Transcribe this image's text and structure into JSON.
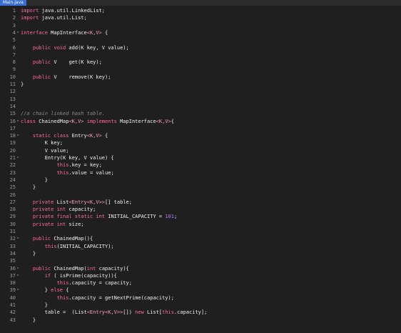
{
  "tab": {
    "label": "Main.java"
  },
  "editor": {
    "lines": [
      {
        "n": "1",
        "fold": "",
        "tokens": [
          [
            "kw",
            "import"
          ],
          [
            "plain",
            " java.util.LinkedList;"
          ]
        ]
      },
      {
        "n": "2",
        "fold": "",
        "tokens": [
          [
            "kw",
            "import"
          ],
          [
            "plain",
            " java.util.List;"
          ]
        ]
      },
      {
        "n": "3",
        "fold": "",
        "tokens": []
      },
      {
        "n": "4",
        "fold": "▾",
        "tokens": [
          [
            "kw",
            "interface"
          ],
          [
            "plain",
            " MapInterface"
          ],
          [
            "typ",
            "<K,V>"
          ],
          [
            "plain",
            " {"
          ]
        ]
      },
      {
        "n": "5",
        "fold": "",
        "tokens": []
      },
      {
        "n": "6",
        "fold": "",
        "tokens": [
          [
            "plain",
            "    "
          ],
          [
            "kw",
            "public void"
          ],
          [
            "plain",
            " add(K key, V value);"
          ]
        ]
      },
      {
        "n": "7",
        "fold": "",
        "tokens": []
      },
      {
        "n": "8",
        "fold": "",
        "tokens": [
          [
            "plain",
            "    "
          ],
          [
            "kw",
            "public"
          ],
          [
            "plain",
            " V    get(K key);"
          ]
        ]
      },
      {
        "n": "9",
        "fold": "",
        "tokens": []
      },
      {
        "n": "10",
        "fold": "",
        "tokens": [
          [
            "plain",
            "    "
          ],
          [
            "kw",
            "public"
          ],
          [
            "plain",
            " V    remove(K key);"
          ]
        ]
      },
      {
        "n": "11",
        "fold": "",
        "tokens": [
          [
            "plain",
            "}"
          ]
        ]
      },
      {
        "n": "12",
        "fold": "",
        "tokens": []
      },
      {
        "n": "13",
        "fold": "",
        "tokens": []
      },
      {
        "n": "14",
        "fold": "",
        "tokens": []
      },
      {
        "n": "15",
        "fold": "",
        "tokens": [
          [
            "com",
            "//a chain linked hash table."
          ]
        ]
      },
      {
        "n": "16",
        "fold": "▾",
        "tokens": [
          [
            "kw",
            "class"
          ],
          [
            "plain",
            " ChainedMap"
          ],
          [
            "typ",
            "<K,V>"
          ],
          [
            "kw",
            " implements"
          ],
          [
            "plain",
            " MapInterface"
          ],
          [
            "typ",
            "<K,V>"
          ],
          [
            "plain",
            "{"
          ]
        ]
      },
      {
        "n": "17",
        "fold": "",
        "tokens": []
      },
      {
        "n": "18",
        "fold": "▾",
        "tokens": [
          [
            "plain",
            "    "
          ],
          [
            "kw",
            "static class"
          ],
          [
            "plain",
            " Entry"
          ],
          [
            "typ",
            "<K,V>"
          ],
          [
            "plain",
            " {"
          ]
        ]
      },
      {
        "n": "19",
        "fold": "",
        "tokens": [
          [
            "plain",
            "        K key;"
          ]
        ]
      },
      {
        "n": "20",
        "fold": "",
        "tokens": [
          [
            "plain",
            "        V value;"
          ]
        ]
      },
      {
        "n": "21",
        "fold": "▾",
        "tokens": [
          [
            "plain",
            "        Entry(K key, V value) {"
          ]
        ]
      },
      {
        "n": "22",
        "fold": "",
        "tokens": [
          [
            "plain",
            "            "
          ],
          [
            "kw",
            "this"
          ],
          [
            "plain",
            ".key = key;"
          ]
        ]
      },
      {
        "n": "23",
        "fold": "",
        "tokens": [
          [
            "plain",
            "            "
          ],
          [
            "kw",
            "this"
          ],
          [
            "plain",
            ".value = value;"
          ]
        ]
      },
      {
        "n": "24",
        "fold": "",
        "tokens": [
          [
            "plain",
            "        }"
          ]
        ]
      },
      {
        "n": "25",
        "fold": "",
        "tokens": [
          [
            "plain",
            "    }"
          ]
        ]
      },
      {
        "n": "26",
        "fold": "",
        "tokens": []
      },
      {
        "n": "27",
        "fold": "",
        "tokens": [
          [
            "plain",
            "    "
          ],
          [
            "kw",
            "private"
          ],
          [
            "plain",
            " List"
          ],
          [
            "typ",
            "<Entry<K,V>>"
          ],
          [
            "plain",
            "[] table;"
          ]
        ]
      },
      {
        "n": "28",
        "fold": "",
        "tokens": [
          [
            "plain",
            "    "
          ],
          [
            "kw",
            "private int"
          ],
          [
            "plain",
            " capacity;"
          ]
        ]
      },
      {
        "n": "29",
        "fold": "",
        "tokens": [
          [
            "plain",
            "    "
          ],
          [
            "kw",
            "private final static int"
          ],
          [
            "plain",
            " INITIAL_CAPACITY = "
          ],
          [
            "num",
            "101"
          ],
          [
            "plain",
            ";"
          ]
        ]
      },
      {
        "n": "30",
        "fold": "",
        "tokens": [
          [
            "plain",
            "    "
          ],
          [
            "kw",
            "private int"
          ],
          [
            "plain",
            " size;"
          ]
        ]
      },
      {
        "n": "31",
        "fold": "",
        "tokens": []
      },
      {
        "n": "32",
        "fold": "▾",
        "tokens": [
          [
            "plain",
            "    "
          ],
          [
            "kw",
            "public"
          ],
          [
            "plain",
            " ChainedMap(){"
          ]
        ]
      },
      {
        "n": "33",
        "fold": "",
        "tokens": [
          [
            "plain",
            "        "
          ],
          [
            "kw",
            "this"
          ],
          [
            "plain",
            "(INITIAL_CAPACITY);"
          ]
        ]
      },
      {
        "n": "34",
        "fold": "",
        "tokens": [
          [
            "plain",
            "    }"
          ]
        ]
      },
      {
        "n": "35",
        "fold": "",
        "tokens": []
      },
      {
        "n": "36",
        "fold": "▾",
        "tokens": [
          [
            "plain",
            "    "
          ],
          [
            "kw",
            "public"
          ],
          [
            "plain",
            " ChainedMap("
          ],
          [
            "kw",
            "int"
          ],
          [
            "plain",
            " capacity){"
          ]
        ]
      },
      {
        "n": "37",
        "fold": "▾",
        "tokens": [
          [
            "plain",
            "        "
          ],
          [
            "kw",
            "if"
          ],
          [
            "plain",
            " ( isPrime(capacity)){"
          ]
        ]
      },
      {
        "n": "38",
        "fold": "",
        "tokens": [
          [
            "plain",
            "            "
          ],
          [
            "kw",
            "this"
          ],
          [
            "plain",
            ".capacity = capacity;"
          ]
        ]
      },
      {
        "n": "39",
        "fold": "▾",
        "tokens": [
          [
            "plain",
            "        } "
          ],
          [
            "kw",
            "else"
          ],
          [
            "plain",
            " {"
          ]
        ]
      },
      {
        "n": "40",
        "fold": "",
        "tokens": [
          [
            "plain",
            "            "
          ],
          [
            "kw",
            "this"
          ],
          [
            "plain",
            ".capacity = getNextPrime(capacity);"
          ]
        ]
      },
      {
        "n": "41",
        "fold": "",
        "tokens": [
          [
            "plain",
            "        }"
          ]
        ]
      },
      {
        "n": "42",
        "fold": "",
        "tokens": [
          [
            "plain",
            "        table =  (List"
          ],
          [
            "typ",
            "<Entry<K,V>>"
          ],
          [
            "plain",
            "[]) "
          ],
          [
            "kw",
            "new"
          ],
          [
            "plain",
            " List["
          ],
          [
            "kw",
            "this"
          ],
          [
            "plain",
            ".capacity];"
          ]
        ]
      },
      {
        "n": "43",
        "fold": "",
        "tokens": [
          [
            "plain",
            "    }"
          ]
        ]
      }
    ]
  }
}
